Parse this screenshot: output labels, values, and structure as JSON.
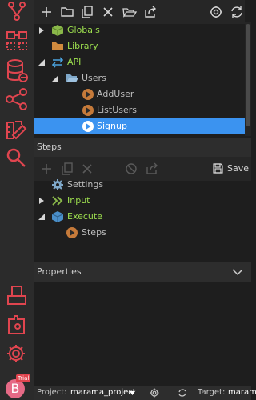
{
  "sidebar": {
    "items": [
      {
        "name": "git-branch-icon"
      },
      {
        "name": "project-flow-icon"
      },
      {
        "name": "database-icon"
      },
      {
        "name": "share-nodes-icon"
      },
      {
        "name": "design-tools-icon"
      },
      {
        "name": "search-icon"
      },
      {
        "name": "publish-icon"
      },
      {
        "name": "plugins-icon"
      },
      {
        "name": "settings-gear-icon"
      }
    ],
    "avatar_letter": "B",
    "trial_badge": "Trial"
  },
  "toolbar": {
    "icons": [
      "add-icon",
      "new-folder-icon",
      "copy-icon",
      "delete-icon",
      "open-folder-icon",
      "export-icon",
      "gear-icon",
      "refresh-icon"
    ]
  },
  "tree": {
    "items": [
      {
        "label": "Globals",
        "icon": "cube-icon",
        "color": "green",
        "level": 0,
        "arrow": "collapsed"
      },
      {
        "label": "Library",
        "icon": "folder-icon",
        "color": "green",
        "level": 0,
        "arrow": "none"
      },
      {
        "label": "API",
        "icon": "api-icon",
        "color": "green",
        "level": 0,
        "arrow": "expanded"
      },
      {
        "label": "Users",
        "icon": "folder-open-icon",
        "color": "gray",
        "level": 1,
        "arrow": "expanded"
      },
      {
        "label": "AddUser",
        "icon": "play-icon",
        "color": "gray",
        "level": 2,
        "arrow": "none"
      },
      {
        "label": "ListUsers",
        "icon": "play-icon",
        "color": "gray",
        "level": 2,
        "arrow": "none"
      },
      {
        "label": "Signup",
        "icon": "play-icon",
        "color": "white",
        "level": 2,
        "arrow": "none",
        "selected": true
      }
    ]
  },
  "steps": {
    "title": "Steps",
    "save_label": "Save",
    "items": [
      {
        "label": "Settings",
        "icon": "gear-icon",
        "color": "gray",
        "level": 0,
        "arrow": "none"
      },
      {
        "label": "Input",
        "icon": "chevrons-right-icon",
        "color": "green",
        "level": 0,
        "arrow": "collapsed"
      },
      {
        "label": "Execute",
        "icon": "cube-icon",
        "color": "green",
        "level": 0,
        "arrow": "expanded"
      },
      {
        "label": "Steps",
        "icon": "play-icon",
        "color": "gray",
        "level": 1,
        "arrow": "none"
      }
    ]
  },
  "properties": {
    "title": "Properties"
  },
  "statusbar": {
    "project_label": "Project:",
    "project_value": "marama_project",
    "target_label": "Target:",
    "target_value": "maram"
  },
  "colors": {
    "accent_red": "#e0454f",
    "selection_blue": "#3b93f0",
    "tree_green": "#9ee04f",
    "api_blue": "#4aa3df",
    "action_orange": "#c57a3a"
  }
}
